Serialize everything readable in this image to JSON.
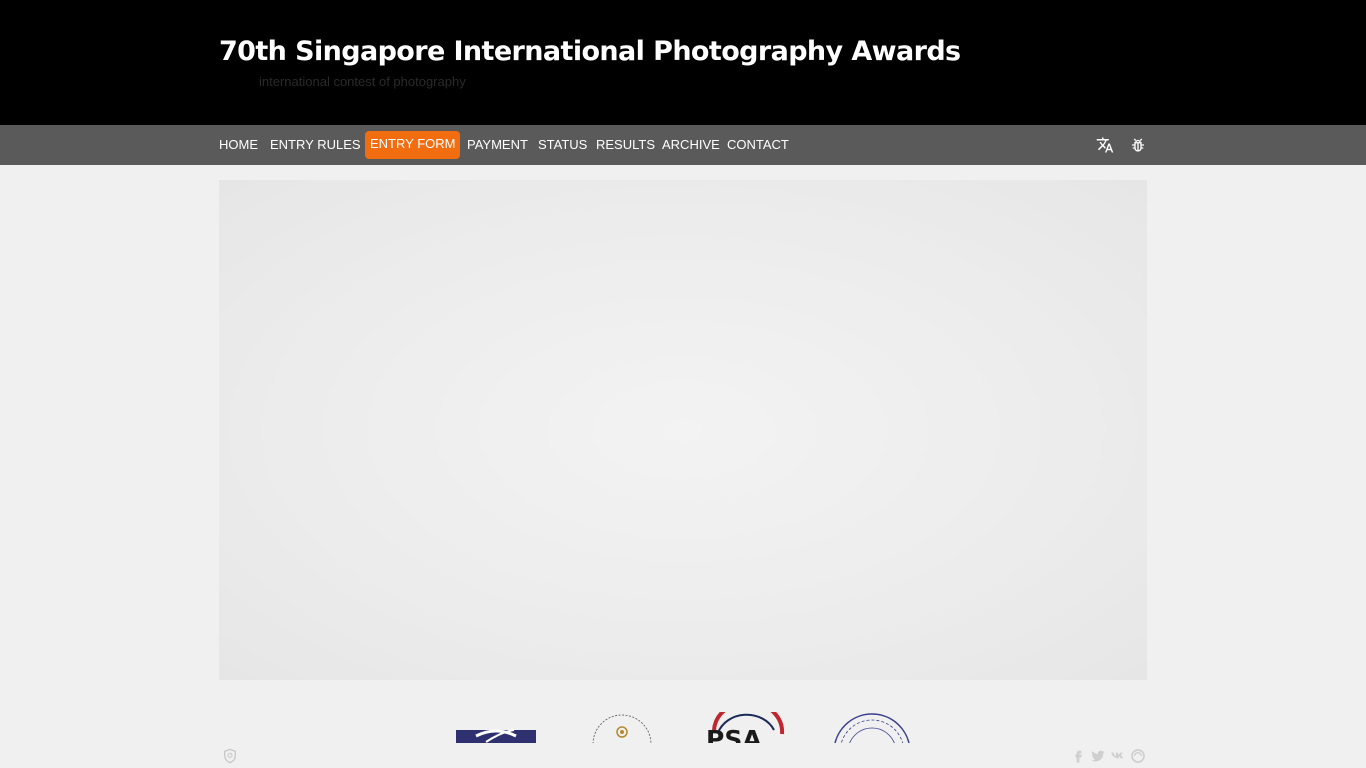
{
  "header": {
    "title": "70th Singapore International Photography Awards",
    "subtitle": "international contest of photography"
  },
  "nav": {
    "items": [
      {
        "label": "HOME",
        "active": false
      },
      {
        "label": "ENTRY RULES",
        "active": false
      },
      {
        "label": "ENTRY FORM",
        "active": true
      },
      {
        "label": "PAYMENT",
        "active": false
      },
      {
        "label": "STATUS",
        "active": false
      },
      {
        "label": "RESULTS",
        "active": false
      },
      {
        "label": "ARCHIVE",
        "active": false
      },
      {
        "label": "CONTACT",
        "active": false
      }
    ],
    "icons": [
      "translate-icon",
      "bug-icon"
    ]
  },
  "logos": {
    "psa_text": "PSA"
  },
  "footer": {
    "social_icons": [
      "facebook-icon",
      "twitter-icon",
      "vk-icon",
      "site-icon"
    ]
  },
  "colors": {
    "header_bg": "#000000",
    "nav_bg": "#5a5a5a",
    "accent": "#f26d10",
    "page_bg": "#f0f0f0"
  }
}
